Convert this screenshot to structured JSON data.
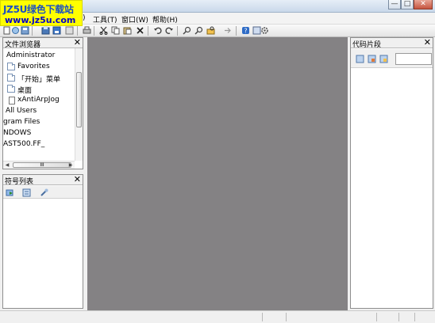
{
  "logo": {
    "line1": "JZ5U绿色下载站",
    "line2": "www.jz5u.com"
  },
  "window": {
    "minimize": "—",
    "maximize": "□",
    "close": "✕"
  },
  "menu": {
    "partial": ")",
    "tools": "工具(T)",
    "window": "窗口(W)",
    "help": "帮助(H)"
  },
  "toolbar": {
    "icons": [
      "new-icon",
      "open-icon",
      "save-icon",
      "save-all-icon",
      "print-icon",
      "cut-icon",
      "copy-icon",
      "paste-icon",
      "delete-icon",
      "undo-icon",
      "redo-icon",
      "find-icon",
      "replace-icon",
      "find-in-files-icon",
      "goto-icon",
      "help-icon",
      "settings-icon"
    ]
  },
  "file_browser": {
    "title": "文件浏览器",
    "items": [
      {
        "label": "Administrator",
        "icon": "none"
      },
      {
        "label": "Favorites",
        "icon": "folder-icon"
      },
      {
        "label": "「开始」菜单",
        "icon": "folder-icon"
      },
      {
        "label": "桌面",
        "icon": "folder-icon"
      },
      {
        "label": "xAntiArpJog",
        "icon": "file-icon"
      },
      {
        "label": "All Users",
        "icon": "none"
      },
      {
        "label": "gram Files",
        "icon": "none"
      },
      {
        "label": "NDOWS",
        "icon": "none"
      },
      {
        "label": "AST500.FF_",
        "icon": "none"
      }
    ],
    "hscroll_grip": "III"
  },
  "symbol_list": {
    "title": "符号列表"
  },
  "code_snippets": {
    "title": "代码片段",
    "search_placeholder": ""
  },
  "close_glyph": "✕",
  "colors": {
    "workspace_bg": "#848284",
    "logo_bg": "#ffff00",
    "logo_text": "#1a4fc4"
  }
}
